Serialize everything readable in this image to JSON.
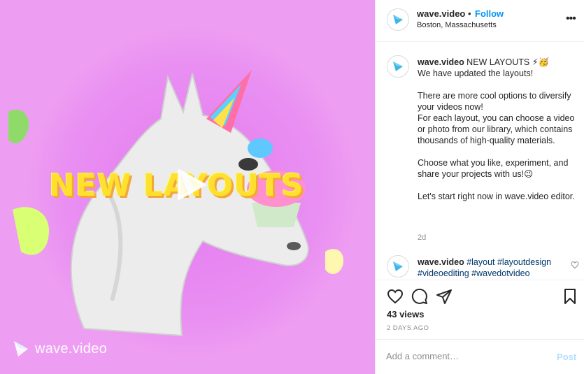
{
  "media": {
    "headline": "NEW LAYOUTS",
    "watermark": "wave.video",
    "background_color": "#ee9ef2",
    "headline_color": "#ffe02e"
  },
  "header": {
    "username": "wave.video",
    "separator": "•",
    "follow_label": "Follow",
    "location": "Boston, Massachusetts"
  },
  "caption": {
    "username": "wave.video",
    "text": " NEW LAYOUTS ⚡🥳\nWe have updated the layouts!\n\nThere are more cool options to diversify your videos now!\nFor each layout, you can choose a video or photo from our library, which contains thousands of high-quality materials.\n\nChoose what you like, experiment, and share your projects with us!😉\n\nLet's start right now in wave.video editor.",
    "time": "2d"
  },
  "reply": {
    "username": "wave.video",
    "hashtags": [
      "#layout",
      "#layoutdesign",
      "#videoediting",
      "#wavedotvideo"
    ]
  },
  "stats": {
    "views": "43 views",
    "date": "2 DAYS AGO"
  },
  "comment_box": {
    "placeholder": "Add a comment…",
    "post_label": "Post"
  },
  "colors": {
    "link_blue": "#0095f6",
    "hashtag": "#00376b",
    "muted": "#8e8e8e",
    "post_disabled": "#b2dffc",
    "brand": "#3fb5e8"
  }
}
